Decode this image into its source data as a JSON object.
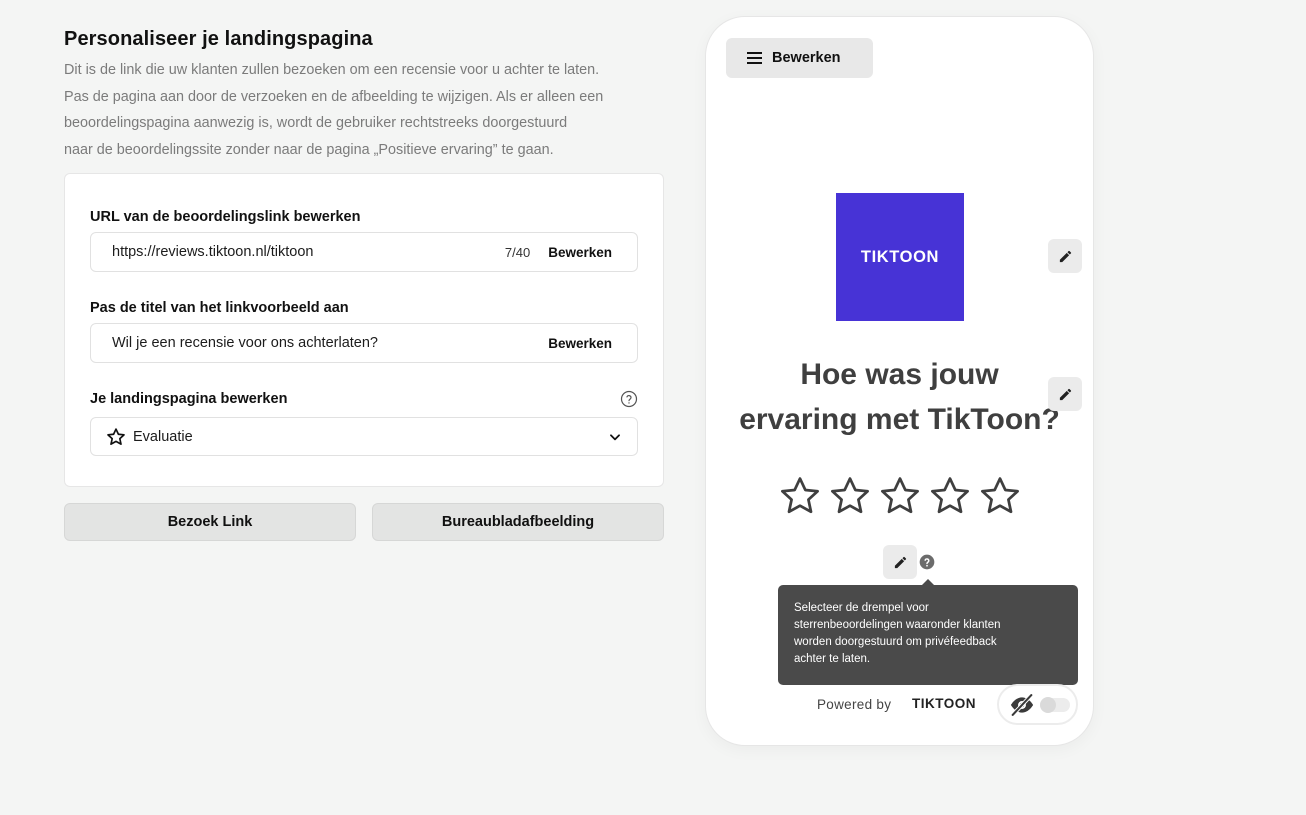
{
  "header": {
    "title": "Personaliseer je landingspagina",
    "description_lines": [
      "Dit is de link die uw klanten zullen bezoeken om een recensie voor u achter te laten.",
      "Pas de pagina aan door de verzoeken en de afbeelding te wijzigen. Als er alleen een",
      "beoordelingspagina aanwezig is, wordt de gebruiker rechtstreeks doorgestuurd",
      "naar de beoordelingssite zonder naar de pagina „Positieve ervaring” te gaan."
    ]
  },
  "form": {
    "url": {
      "label": "URL van de beoordelingslink bewerken",
      "value": "https://reviews.tiktoon.nl/tiktoon",
      "count": "7/40",
      "edit_label": "Bewerken"
    },
    "title": {
      "label": "Pas de titel van het linkvoorbeeld aan",
      "value": "Wil je een recensie voor ons achterlaten?",
      "edit_label": "Bewerken"
    },
    "landing": {
      "label": "Je landingspagina bewerken",
      "selected": "Evaluatie"
    }
  },
  "buttons": {
    "visit": "Bezoek Link",
    "desktop": "Bureaubladafbeelding"
  },
  "preview": {
    "edit_label": "Bewerken",
    "logo_text": "TIKTOON",
    "question_lines": [
      "Hoe was jouw",
      "ervaring met TikToon?"
    ],
    "stars_count": 5,
    "tooltip_lines": [
      "Selecteer de drempel voor",
      "sterrenbeoordelingen waaronder klanten",
      "worden doorgestuurd om privéfeedback",
      "achter te laten."
    ],
    "powered_by": "Powered by",
    "powered_logo": "TIKTOON",
    "visibility_toggle_on": false
  },
  "colors": {
    "background": "#f4f5f4",
    "brand": "#4733d6",
    "tooltip": "#4a4a4a",
    "question_text": "#3f3f3f"
  },
  "icons": {
    "menu": "menu-icon",
    "pencil": "pencil-icon",
    "help": "help-circle-icon",
    "star": "star-outline-icon",
    "chevron": "chevron-down-icon",
    "eye_off": "eye-off-icon"
  }
}
